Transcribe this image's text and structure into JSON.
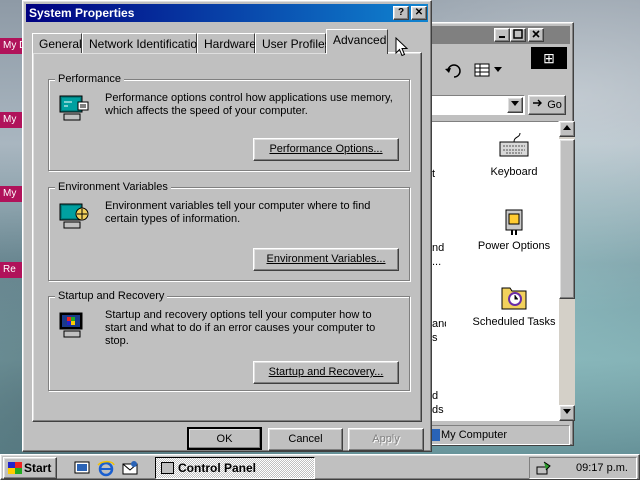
{
  "desktop": {
    "labels": [
      "My D",
      "My",
      "My",
      "Re"
    ]
  },
  "control_panel": {
    "go_label": "Go",
    "items": [
      {
        "label": "Keyboard",
        "icon": "keyboard-icon"
      },
      {
        "label": "Power Options",
        "icon": "power-options-icon"
      },
      {
        "label": "Scheduled Tasks",
        "icon": "scheduled-tasks-icon"
      }
    ],
    "left_cut": [
      "t",
      "nd",
      "...",
      "and",
      "s",
      "d",
      "ds"
    ],
    "status_label": "My Computer"
  },
  "dialog": {
    "title": "System Properties",
    "help_glyph": "?",
    "close_glyph": "✕",
    "tabs": [
      {
        "label": "General"
      },
      {
        "label": "Network Identification"
      },
      {
        "label": "Hardware"
      },
      {
        "label": "User Profiles"
      },
      {
        "label": "Advanced",
        "active": true
      }
    ],
    "groups": [
      {
        "title": "Performance",
        "description": "Performance options control how applications use memory, which affects the speed of your computer.",
        "button": "Performance Options..."
      },
      {
        "title": "Environment Variables",
        "description": "Environment variables tell your computer where to find certain types of information.",
        "button": "Environment Variables..."
      },
      {
        "title": "Startup and Recovery",
        "description": "Startup and recovery options tell your computer how to start and what to do if an error causes your computer to stop.",
        "button": "Startup and Recovery..."
      }
    ],
    "ok_label": "OK",
    "cancel_label": "Cancel",
    "apply_label": "Apply"
  },
  "taskbar": {
    "start_label": "Start",
    "task_label": "Control Panel",
    "clock": "09:17 p.m."
  },
  "colors": {
    "title_active": "#000080",
    "title_gradient_end": "#1084d0",
    "face": "#c0c0c0",
    "desktop_label": "#b0125a"
  }
}
